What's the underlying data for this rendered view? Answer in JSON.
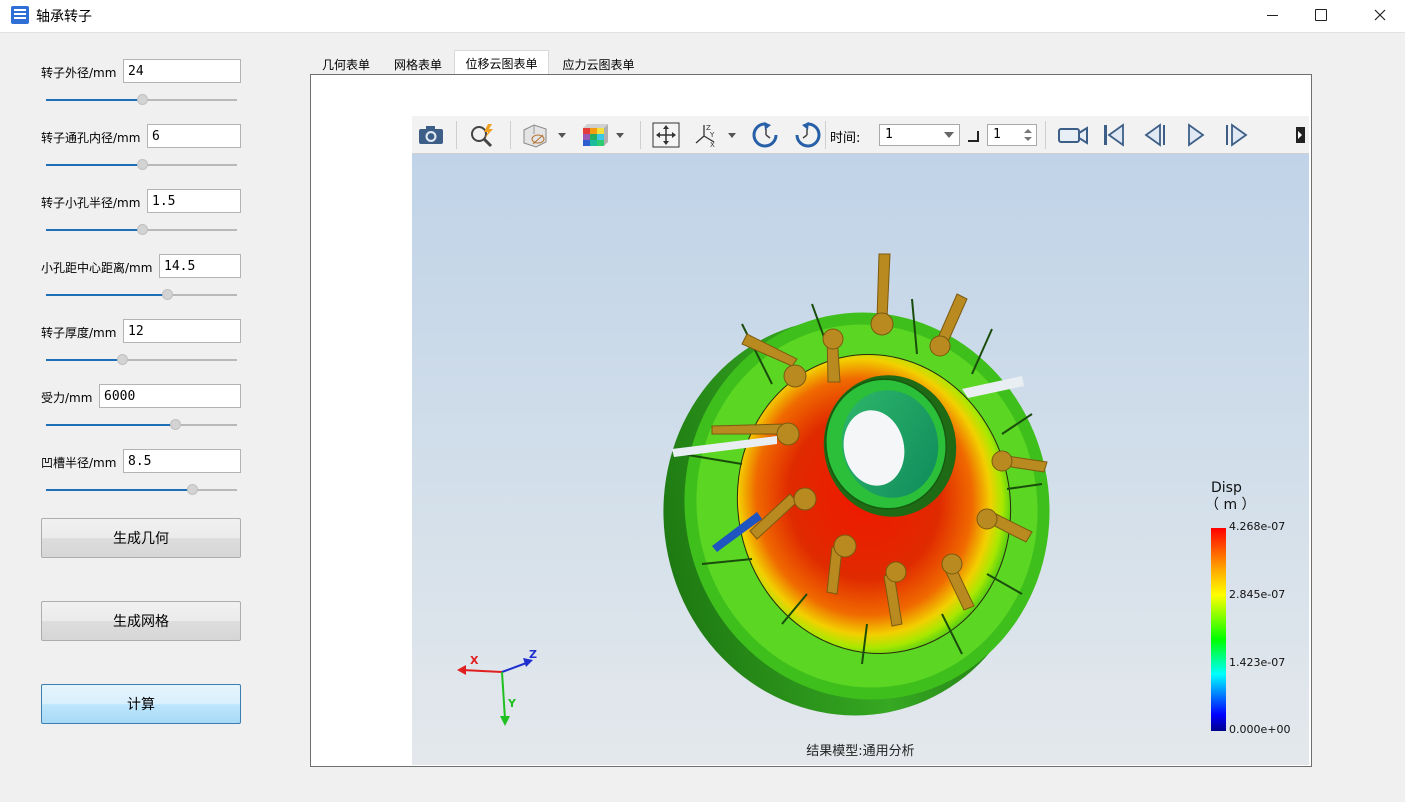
{
  "window": {
    "title": "轴承转子"
  },
  "params": [
    {
      "label": "转子外径/mm",
      "value": "24",
      "level": 0.5
    },
    {
      "label": "转子通孔内径/mm",
      "value": "6",
      "level": 0.5
    },
    {
      "label": "转子小孔半径/mm",
      "value": "1.5",
      "level": 0.5
    },
    {
      "label": "小孔距中心距离/mm",
      "value": "14.5",
      "level": 0.64
    },
    {
      "label": "转子厚度/mm",
      "value": "12",
      "level": 0.4
    },
    {
      "label": "受力/mm",
      "value": "6000",
      "level": 0.68
    },
    {
      "label": "凹槽半径/mm",
      "value": "8.5",
      "level": 0.77
    }
  ],
  "buttons": {
    "geometry": "生成几何",
    "mesh": "生成网格",
    "calc": "计算"
  },
  "tabs": [
    "几何表单",
    "网格表单",
    "位移云图表单",
    "应力云图表单"
  ],
  "active_tab": 2,
  "toolbar": {
    "time_label": "时间:",
    "time_value": "1",
    "step_value": "1"
  },
  "viewport": {
    "status": "结果模型:通用分析",
    "legend_title": "Disp",
    "legend_unit": "（ m ）",
    "legend_values": [
      "4.268e-07",
      "2.845e-07",
      "1.423e-07",
      "0.000e+00"
    ],
    "axes": {
      "x": "X",
      "y": "Y",
      "z": "Z"
    }
  },
  "colors": {
    "slider_fill": "#1f6fb8",
    "calc_button": "#bde6fd",
    "viewport_top": "#c0d3e8"
  }
}
